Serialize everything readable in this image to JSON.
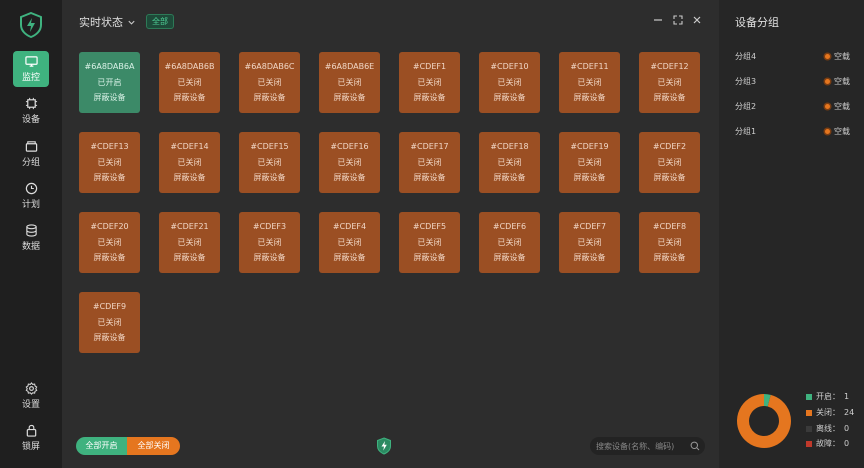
{
  "nav": {
    "items": [
      {
        "key": "monitor",
        "label": "监控",
        "active": true
      },
      {
        "key": "device",
        "label": "设备",
        "active": false
      },
      {
        "key": "group",
        "label": "分组",
        "active": false
      },
      {
        "key": "plan",
        "label": "计划",
        "active": false
      },
      {
        "key": "data",
        "label": "数据",
        "active": false
      }
    ],
    "bottom": [
      {
        "key": "settings",
        "label": "设置"
      },
      {
        "key": "lock",
        "label": "锁屏"
      }
    ]
  },
  "header": {
    "title": "实时状态",
    "filter_badge": "全部"
  },
  "tiles": [
    {
      "id": "#6A8DAB6A",
      "status": "已开启",
      "action": "屏蔽设备",
      "on": true
    },
    {
      "id": "#6A8DAB6B",
      "status": "已关闭",
      "action": "屏蔽设备",
      "on": false
    },
    {
      "id": "#6A8DAB6C",
      "status": "已关闭",
      "action": "屏蔽设备",
      "on": false
    },
    {
      "id": "#6A8DAB6E",
      "status": "已关闭",
      "action": "屏蔽设备",
      "on": false
    },
    {
      "id": "#CDEF1",
      "status": "已关闭",
      "action": "屏蔽设备",
      "on": false
    },
    {
      "id": "#CDEF10",
      "status": "已关闭",
      "action": "屏蔽设备",
      "on": false
    },
    {
      "id": "#CDEF11",
      "status": "已关闭",
      "action": "屏蔽设备",
      "on": false
    },
    {
      "id": "#CDEF12",
      "status": "已关闭",
      "action": "屏蔽设备",
      "on": false
    },
    {
      "id": "#CDEF13",
      "status": "已关闭",
      "action": "屏蔽设备",
      "on": false
    },
    {
      "id": "#CDEF14",
      "status": "已关闭",
      "action": "屏蔽设备",
      "on": false
    },
    {
      "id": "#CDEF15",
      "status": "已关闭",
      "action": "屏蔽设备",
      "on": false
    },
    {
      "id": "#CDEF16",
      "status": "已关闭",
      "action": "屏蔽设备",
      "on": false
    },
    {
      "id": "#CDEF17",
      "status": "已关闭",
      "action": "屏蔽设备",
      "on": false
    },
    {
      "id": "#CDEF18",
      "status": "已关闭",
      "action": "屏蔽设备",
      "on": false
    },
    {
      "id": "#CDEF19",
      "status": "已关闭",
      "action": "屏蔽设备",
      "on": false
    },
    {
      "id": "#CDEF2",
      "status": "已关闭",
      "action": "屏蔽设备",
      "on": false
    },
    {
      "id": "#CDEF20",
      "status": "已关闭",
      "action": "屏蔽设备",
      "on": false
    },
    {
      "id": "#CDEF21",
      "status": "已关闭",
      "action": "屏蔽设备",
      "on": false
    },
    {
      "id": "#CDEF3",
      "status": "已关闭",
      "action": "屏蔽设备",
      "on": false
    },
    {
      "id": "#CDEF4",
      "status": "已关闭",
      "action": "屏蔽设备",
      "on": false
    },
    {
      "id": "#CDEF5",
      "status": "已关闭",
      "action": "屏蔽设备",
      "on": false
    },
    {
      "id": "#CDEF6",
      "status": "已关闭",
      "action": "屏蔽设备",
      "on": false
    },
    {
      "id": "#CDEF7",
      "status": "已关闭",
      "action": "屏蔽设备",
      "on": false
    },
    {
      "id": "#CDEF8",
      "status": "已关闭",
      "action": "屏蔽设备",
      "on": false
    },
    {
      "id": "#CDEF9",
      "status": "已关闭",
      "action": "屏蔽设备",
      "on": false
    }
  ],
  "footer": {
    "all_on": "全部开启",
    "all_off": "全部关闭",
    "search_placeholder": "搜索设备(名称、编码)"
  },
  "panel": {
    "title": "设备分组",
    "groups": [
      {
        "name": "分组4",
        "status": "空载"
      },
      {
        "name": "分组3",
        "status": "空载"
      },
      {
        "name": "分组2",
        "status": "空载"
      },
      {
        "name": "分组1",
        "status": "空载"
      }
    ],
    "legend": [
      {
        "label": "开启：",
        "value": 1,
        "color": "#3fb27f"
      },
      {
        "label": "关闭：",
        "value": 24,
        "color": "#e5761f"
      },
      {
        "label": "离线：",
        "value": 0,
        "color": "#3a3a3a"
      },
      {
        "label": "故障：",
        "value": 0,
        "color": "#c0392b"
      }
    ]
  },
  "colors": {
    "accent": "#3fb27f",
    "off": "#9b4f23",
    "orange": "#e5761f"
  }
}
